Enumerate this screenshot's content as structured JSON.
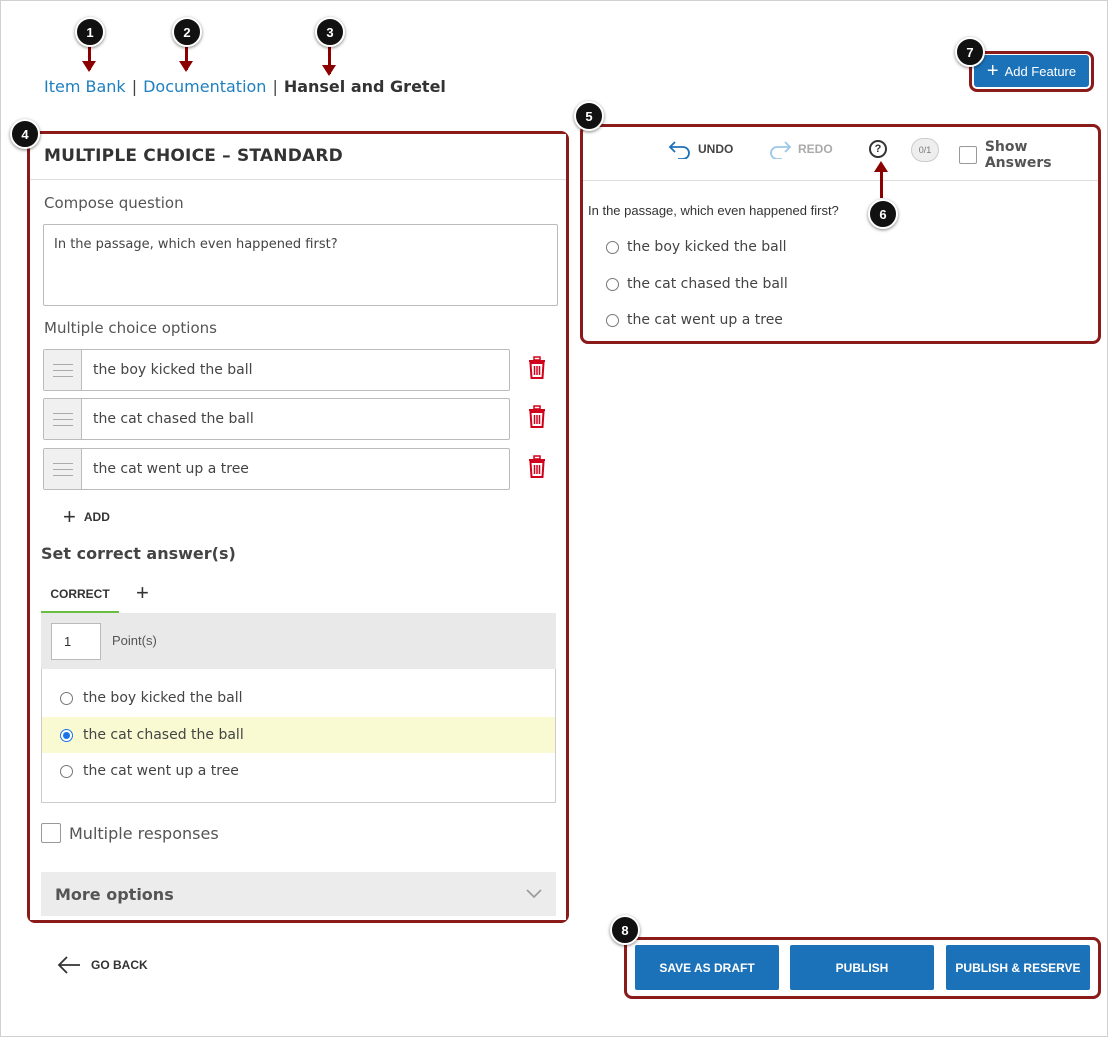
{
  "breadcrumb": {
    "item_bank": "Item Bank",
    "separator": "|",
    "documentation": "Documentation",
    "current": "Hansel and Gretel"
  },
  "header": {
    "add_feature_label": "Add Feature"
  },
  "callouts": [
    "1",
    "2",
    "3",
    "4",
    "5",
    "6",
    "7",
    "8"
  ],
  "editor": {
    "title": "MULTIPLE CHOICE – STANDARD",
    "compose_label": "Compose question",
    "question_text": "In the passage, which even happened first?",
    "options_label": "Multiple choice options",
    "options": [
      "the boy kicked the ball",
      "the cat chased the ball",
      "the cat went up a tree"
    ],
    "add_label": "ADD",
    "set_correct_label": "Set correct answer(s)",
    "correct_tab_label": "CORRECT",
    "points_value": "1",
    "points_label": "Point(s)",
    "answers": [
      "the boy kicked the ball",
      "the cat chased the ball",
      "the cat went up a tree"
    ],
    "selected_answer_index": 1,
    "multiple_responses_label": "Multiple responses",
    "more_options_label": "More options"
  },
  "preview": {
    "undo_label": "UNDO",
    "redo_label": "REDO",
    "help_symbol": "?",
    "score": "0/1",
    "show_answers_label": "Show Answers",
    "question": "In the passage, which even happened first?",
    "options": [
      "the boy kicked the ball",
      "the cat chased the ball",
      "the cat went up a tree"
    ]
  },
  "footer": {
    "go_back_label": "GO BACK",
    "save_draft_label": "SAVE AS DRAFT",
    "publish_label": "PUBLISH",
    "publish_reserve_label": "PUBLISH & RESERVE"
  },
  "colors": {
    "accent_blue": "#1c72b8",
    "link_blue": "#1e7fbf",
    "annotation_red": "#8b1a1a",
    "delete_red": "#d0021b",
    "correct_green": "#6abf40",
    "selected_row": "#fafad2"
  }
}
